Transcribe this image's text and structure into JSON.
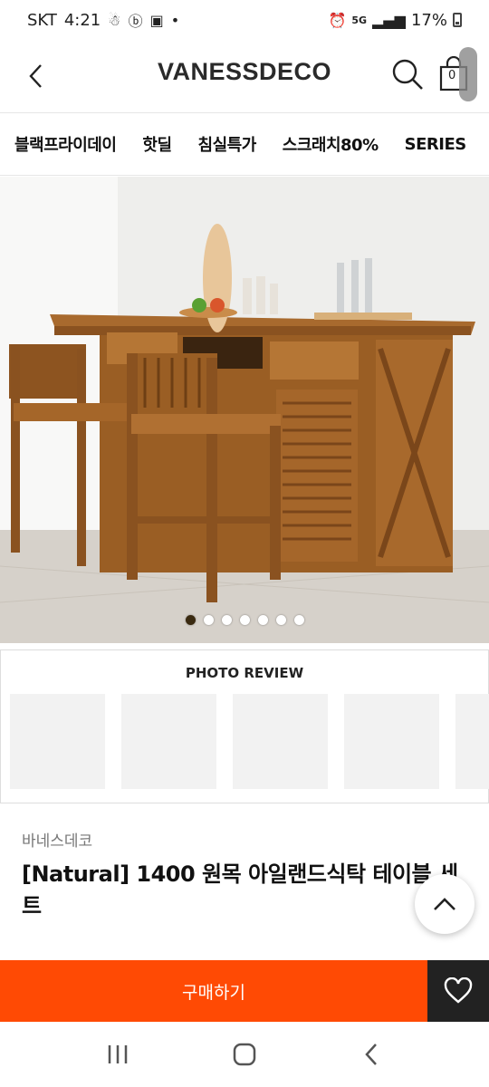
{
  "status": {
    "carrier": "SKT",
    "time": "4:21",
    "network": "5G",
    "battery": "17%"
  },
  "header": {
    "logo": "VANESSDECO",
    "cart_count": "0"
  },
  "categories": [
    "블랙프라이데이",
    "핫딜",
    "침실특가",
    "스크래치80%",
    "SERIES"
  ],
  "hero": {
    "slide_count": 7,
    "active_slide": 0
  },
  "review": {
    "title": "PHOTO REVIEW"
  },
  "product": {
    "brand": "바네스데코",
    "title": "[Natural] 1400 원목 아일랜드식탁 테이블 세트"
  },
  "buy": {
    "label": "구매하기"
  },
  "colors": {
    "accent": "#ff4a04",
    "wish_bg": "#222222"
  }
}
